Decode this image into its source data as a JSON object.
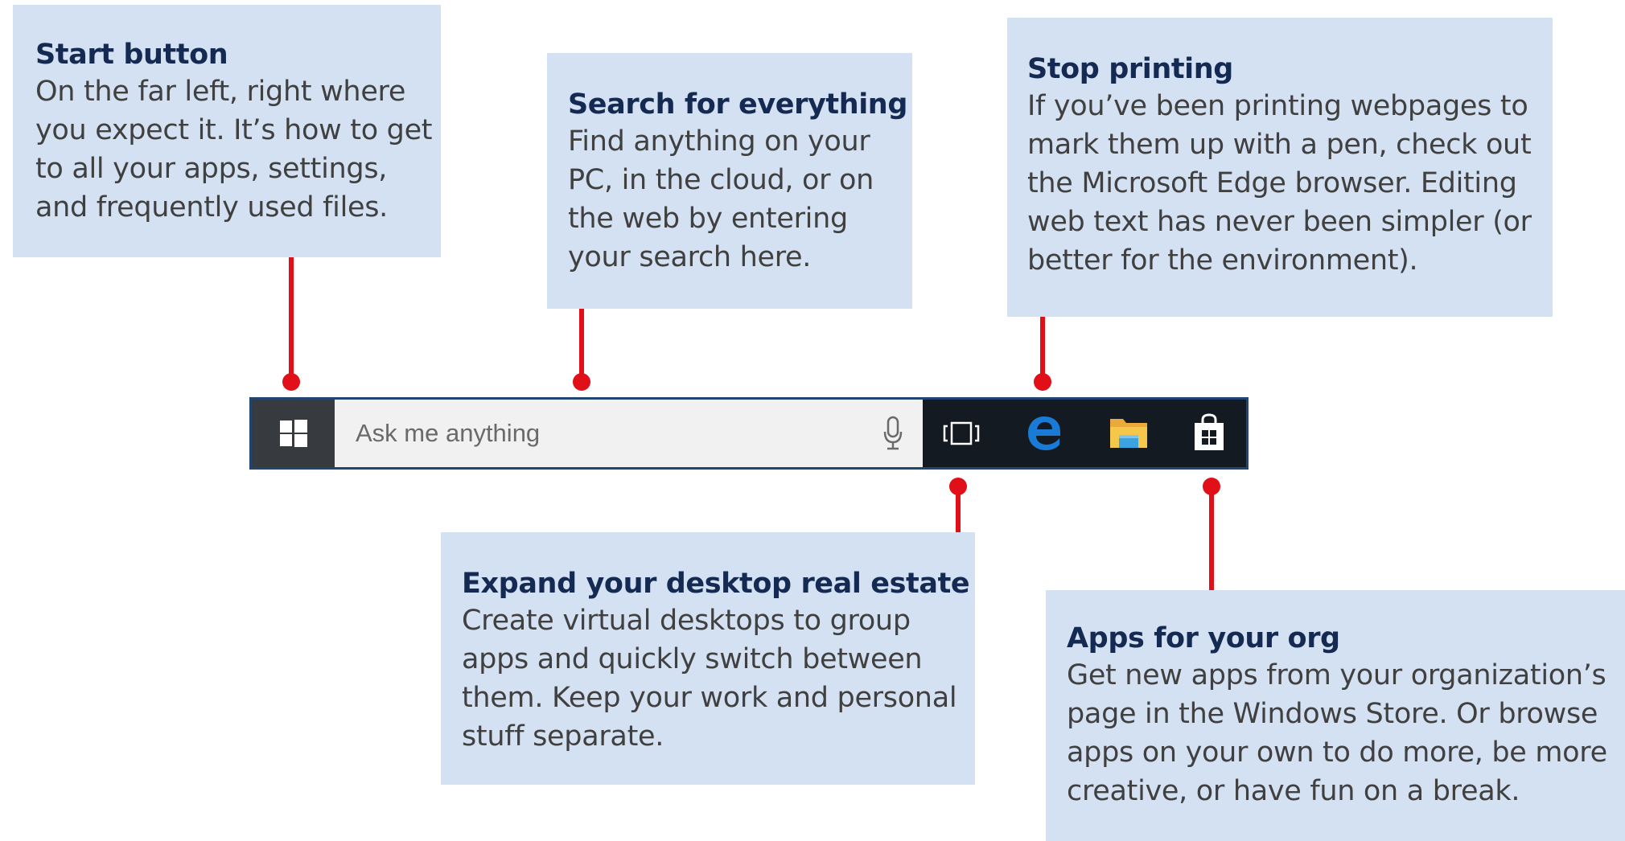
{
  "callouts": {
    "start": {
      "title": "Start button",
      "lines": [
        "On the far left, right where",
        "you expect it. It’s how to get",
        "to all your apps, settings,",
        "and frequently used files."
      ]
    },
    "search": {
      "title": "Search for everything",
      "lines": [
        "Find anything on your",
        "PC, in the cloud, or on",
        "the web by entering",
        "your search here."
      ]
    },
    "printing": {
      "title": "Stop printing",
      "lines": [
        "If you’ve been printing webpages to",
        "mark them up with a pen, check out",
        "the Microsoft Edge browser. Editing",
        "web text has never been simpler (or",
        "better for the environment)."
      ]
    },
    "desktop": {
      "title": "Expand your desktop real estate",
      "lines": [
        "Create virtual desktops to group",
        "apps and quickly switch between",
        "them. Keep your work and personal",
        "stuff separate."
      ]
    },
    "apps": {
      "title": "Apps for your org",
      "lines": [
        "Get new apps from your organization’s",
        "page in the Windows Store. Or browse",
        "apps on your own to do more, be more",
        "creative, or have fun on a break."
      ]
    }
  },
  "taskbar": {
    "search_placeholder": "Ask me anything",
    "icons": {
      "start": "windows-logo-icon",
      "mic": "microphone-icon",
      "task_view": "task-view-icon",
      "edge": "edge-icon",
      "explorer": "file-explorer-icon",
      "store": "store-icon"
    }
  },
  "colors": {
    "callout_bg": "#d4e1f2",
    "callout_title": "#152a52",
    "connector": "#e10f17",
    "taskbar": "#131a21",
    "edge_blue": "#1a7bd6",
    "folder_yellow": "#f5c74a"
  }
}
